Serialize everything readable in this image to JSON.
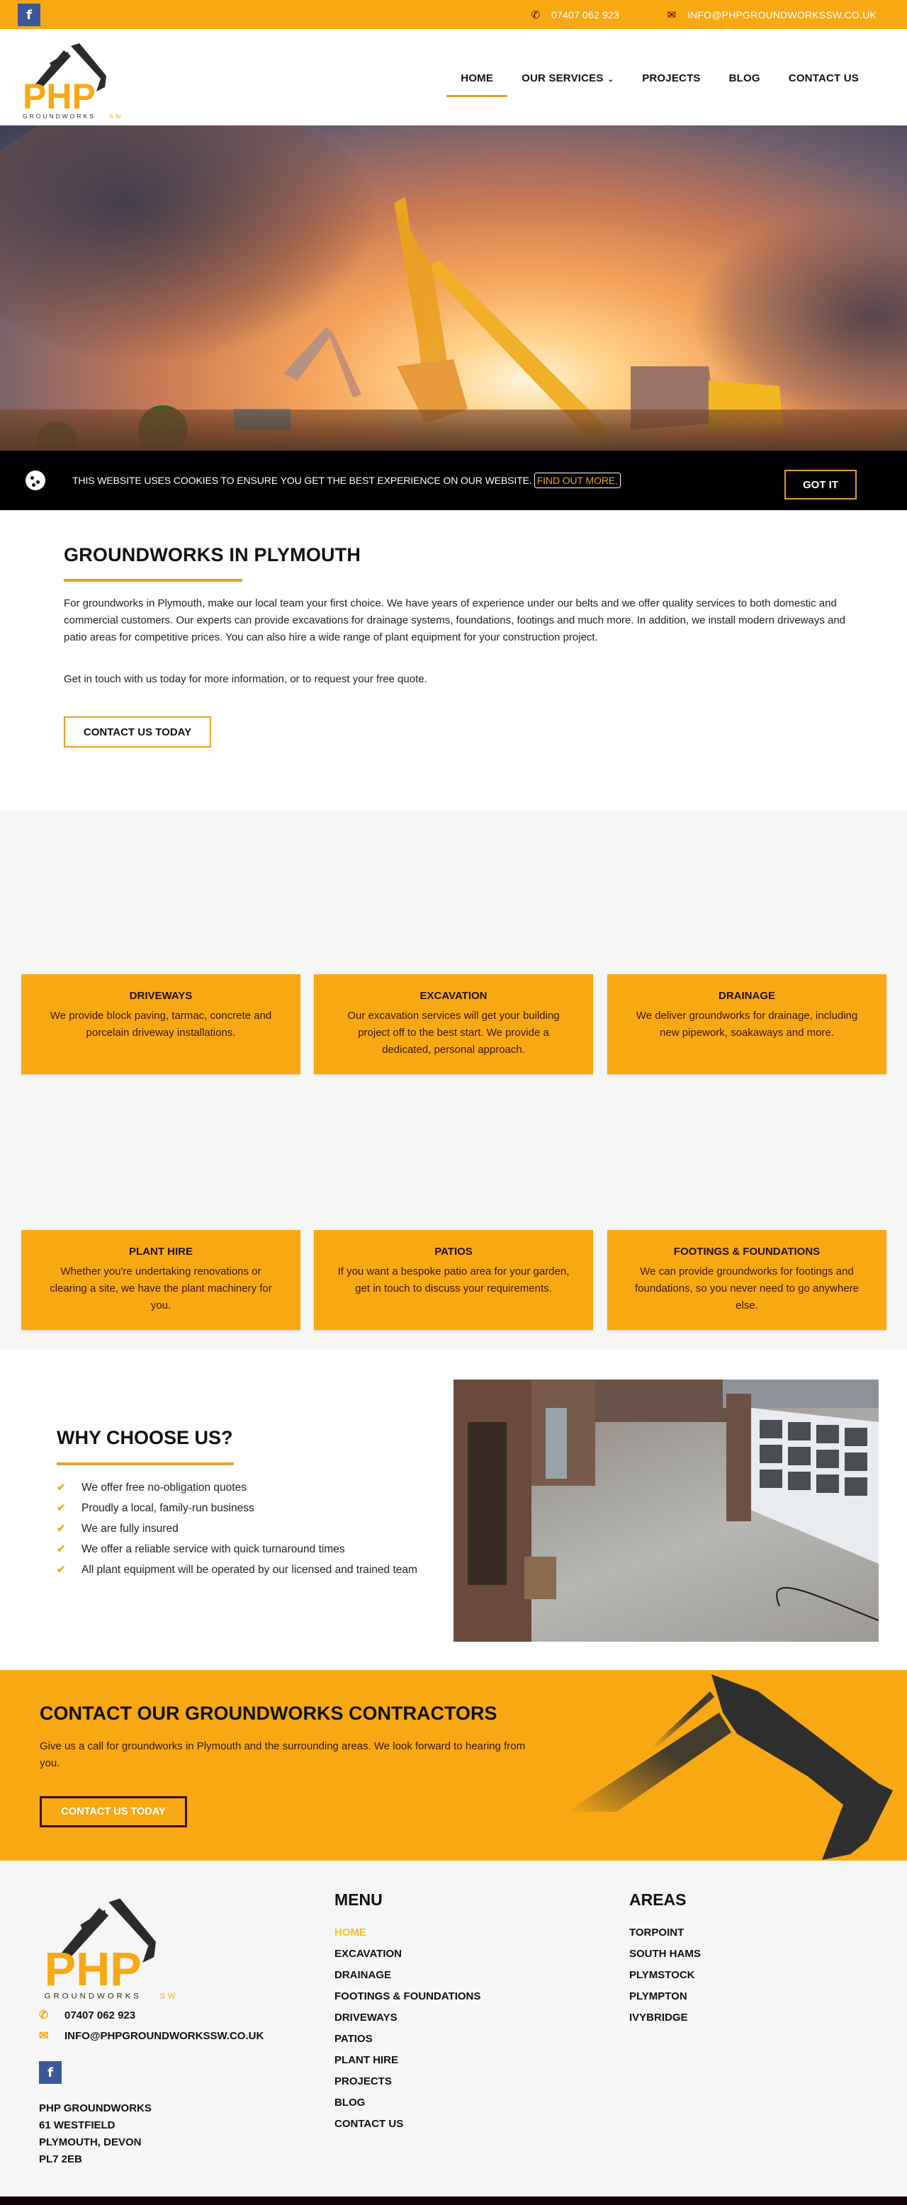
{
  "topbar": {
    "facebook_label": "f",
    "phone": "07407 062 923",
    "email": "INFO@PHPGROUNDWORKSSW.CO.UK"
  },
  "logo": {
    "main": "PHP",
    "sub": "GROUNDWORKS",
    "sub_accent": "SW"
  },
  "nav": {
    "items": [
      {
        "label": "HOME",
        "active": true
      },
      {
        "label": "OUR SERVICES",
        "has_dropdown": true
      },
      {
        "label": "PROJECTS"
      },
      {
        "label": "BLOG"
      },
      {
        "label": "CONTACT US"
      }
    ],
    "dropdown_glyph": "⌄"
  },
  "cookie": {
    "message": "THIS WEBSITE USES COOKIES TO ENSURE YOU GET THE BEST EXPERIENCE ON OUR WEBSITE.",
    "link": "FIND OUT MORE.",
    "accept": "GOT IT"
  },
  "intro": {
    "title": "GROUNDWORKS IN PLYMOUTH",
    "paragraph1": "For groundworks in Plymouth, make our local team your first choice. We have years of experience under our belts and we offer quality services to both domestic and commercial customers. Our experts can provide excavations for drainage systems, foundations, footings and much more. In addition, we install modern driveways and patio areas for competitive prices. You can also hire a wide range of plant equipment for your construction project.",
    "paragraph2": "Get in touch with us today for more information, or to request your free quote.",
    "button": "CONTACT US TODAY"
  },
  "services": [
    {
      "title": "DRIVEWAYS",
      "text": "We provide block paving, tarmac, concrete and porcelain driveway installations."
    },
    {
      "title": "EXCAVATION",
      "text": "Our excavation services will get your building project off to the best start. We provide a dedicated, personal approach."
    },
    {
      "title": "DRAINAGE",
      "text": "We deliver groundworks for drainage, including new pipework, soakaways and more."
    },
    {
      "title": "PLANT HIRE",
      "text": "Whether you're undertaking renovations or clearing a site, we have the plant machinery for you."
    },
    {
      "title": "PATIOS",
      "text": "If you want a bespoke patio area for your garden, get in touch to discuss your requirements."
    },
    {
      "title": "FOOTINGS & FOUNDATIONS",
      "text": "We can provide groundworks for footings and foundations, so you never need to go anywhere else."
    }
  ],
  "why": {
    "title": "WHY CHOOSE US?",
    "check_glyph": "✔",
    "items": [
      "We offer free no-obligation quotes",
      "Proudly a local, family-run business",
      "We are fully insured",
      "We offer a reliable service with quick turnaround times",
      "All plant equipment will be operated by our licensed and trained team"
    ]
  },
  "cta": {
    "title": "CONTACT OUR GROUNDWORKS CONTRACTORS",
    "text": "Give us a call for groundworks in Plymouth and the surrounding areas. We look forward to hearing from you.",
    "button": "CONTACT US TODAY"
  },
  "footer": {
    "phone": "07407 062 923",
    "email": "INFO@PHPGROUNDWORKSSW.CO.UK",
    "facebook_label": "f",
    "address": [
      "PHP GROUNDWORKS",
      "61 WESTFIELD",
      "PLYMOUTH, DEVON",
      "PL7 2EB"
    ],
    "menu_title": "MENU",
    "menu": [
      {
        "label": "HOME",
        "active": true
      },
      {
        "label": "EXCAVATION"
      },
      {
        "label": "DRAINAGE"
      },
      {
        "label": "FOOTINGS & FOUNDATIONS"
      },
      {
        "label": "DRIVEWAYS"
      },
      {
        "label": "PATIOS"
      },
      {
        "label": "PLANT HIRE"
      },
      {
        "label": "PROJECTS"
      },
      {
        "label": "BLOG"
      },
      {
        "label": "CONTACT US"
      }
    ],
    "areas_title": "AREAS",
    "areas": [
      "TORPOINT",
      "SOUTH HAMS",
      "PLYMSTOCK",
      "PLYMPTON",
      "IVYBRIDGE"
    ]
  },
  "colors": {
    "brand_orange": "#f7a813",
    "accent_gold": "#e0a22c",
    "facebook_blue": "#3b5998",
    "dark": "#111111"
  }
}
